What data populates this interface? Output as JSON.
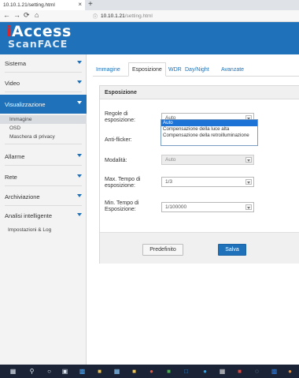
{
  "browser": {
    "tab_title": "10.10.1.21/setting.html",
    "close_glyph": "×",
    "newtab_glyph": "+",
    "url_host": "10.10.1.21",
    "url_path": "/setting.html",
    "nav": {
      "back": "←",
      "forward": "→",
      "reload": "⟳",
      "home": "⌂"
    }
  },
  "brand": {
    "line1_i": "i",
    "line1_rest": "Access",
    "line2": "ScanFACE",
    "header_color": "#1f72b9",
    "logo_red": "#d8262c"
  },
  "sidebar": {
    "items": [
      {
        "label": "Sistema"
      },
      {
        "label": "Video"
      },
      {
        "label": "Visualizzazione",
        "active": true
      },
      {
        "label": "Allarme"
      },
      {
        "label": "Rete"
      },
      {
        "label": "Archiviazione"
      },
      {
        "label": "Analisi intelligente"
      }
    ],
    "subitems": [
      {
        "label": "Immagine",
        "selected": true
      },
      {
        "label": "OSD"
      },
      {
        "label": "Maschera di privacy"
      }
    ],
    "extra": "Impostazioni & Log"
  },
  "tabs": [
    {
      "label": "Immagine"
    },
    {
      "label": "Esposizione",
      "active": true
    },
    {
      "label": "WDR"
    },
    {
      "label": "Day/Night"
    },
    {
      "label": "Avanzate"
    }
  ],
  "panel": {
    "title": "Esposizione",
    "fields": {
      "regole": {
        "label": "Regole di esposizione:",
        "value": "Auto"
      },
      "antiflicker": {
        "label": "Anti-flicker:",
        "value": ""
      },
      "modalita": {
        "label": "Modalità:",
        "value": "Auto"
      },
      "max_tempo": {
        "label": "Max. Tempo di esposizione:",
        "value": "1/3"
      },
      "min_tempo": {
        "label": "Min. Tempo di Esposizione:",
        "value": "1/100000"
      }
    },
    "dropdown_options": [
      {
        "label": "Auto",
        "selected": true
      },
      {
        "label": "Compensazione della luce alta"
      },
      {
        "label": "Compensazione della retroilluminazione"
      }
    ],
    "buttons": {
      "default": "Predefinito",
      "save": "Salva"
    }
  },
  "taskbar": {
    "icons": [
      "windows-icon",
      "search-icon",
      "cortana-icon",
      "task-view-icon",
      "network-icon",
      "store-icon",
      "files-icon",
      "mail-icon",
      "chrome-icon",
      "edge-icon",
      "teams-icon",
      "skype-icon",
      "calculator-icon",
      "pdf-icon",
      "wifi-icon",
      "outlook-icon",
      "firefox-icon"
    ]
  }
}
